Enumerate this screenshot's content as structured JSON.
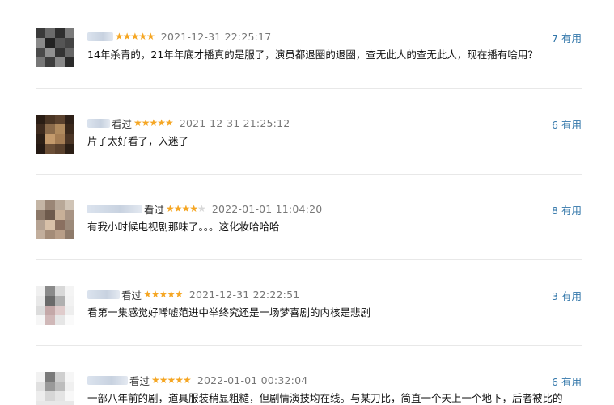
{
  "comments": [
    {
      "watched": "",
      "rating": 5,
      "date": "2021-12-31 22:25:17",
      "useful_count": "7",
      "useful_label": "有用",
      "text": "14年杀青的，21年年底才播真的是服了，演员都退圈的退圈，查无此人的查无此人，现在播有啥用？"
    },
    {
      "watched": "看过",
      "rating": 5,
      "date": "2021-12-31 21:25:12",
      "useful_count": "6",
      "useful_label": "有用",
      "text": "片子太好看了，入迷了"
    },
    {
      "watched": "看过",
      "rating": 4,
      "date": "2022-01-01 11:04:20",
      "useful_count": "8",
      "useful_label": "有用",
      "text": "有我小时候电视剧那味了。。。这化妆哈哈哈"
    },
    {
      "watched": "看过",
      "rating": 5,
      "date": "2021-12-31 22:22:51",
      "useful_count": "3",
      "useful_label": "有用",
      "text": "看第一集感觉好唏嘘范进中举终究还是一场梦喜剧的内核是悲剧"
    },
    {
      "watched": "看过",
      "rating": 5,
      "date": "2022-01-01 00:32:04",
      "useful_count": "6",
      "useful_label": "有用",
      "text": "一部八年前的剧，道具服装稍显粗糙，但剧情演技均在线。与某刀比，简直一个天上一个地下，后者被比的"
    }
  ]
}
